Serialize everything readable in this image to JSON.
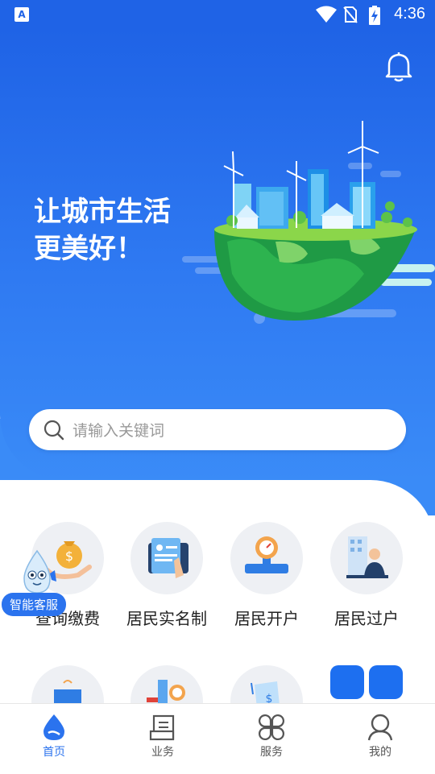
{
  "statusbar": {
    "app_icon": "A",
    "time": "4:36",
    "icons": [
      "wifi-icon",
      "no-sim-icon",
      "battery-charging-icon"
    ]
  },
  "hero": {
    "slogan_line1": "让城市生活",
    "slogan_line2": "更美好！"
  },
  "search": {
    "placeholder": "请输入关键词"
  },
  "services": [
    {
      "label": "查询缴费",
      "icon": "money-bag-icon"
    },
    {
      "label": "居民实名制",
      "icon": "id-card-icon"
    },
    {
      "label": "居民开户",
      "icon": "water-meter-icon"
    },
    {
      "label": "居民过户",
      "icon": "transfer-person-icon"
    }
  ],
  "services_row2": [
    "building-icon",
    "pipe-meter-icon",
    "bill-icon",
    "more-tiles-icon"
  ],
  "assistant": {
    "label": "智能客服"
  },
  "tabs": [
    {
      "label": "首页",
      "icon": "water-drop-icon",
      "active": true
    },
    {
      "label": "业务",
      "icon": "document-icon",
      "active": false
    },
    {
      "label": "服务",
      "icon": "clover-icon",
      "active": false
    },
    {
      "label": "我的",
      "icon": "person-icon",
      "active": false
    }
  ],
  "colors": {
    "primary": "#2b73ee",
    "hero_top": "#1f63e6",
    "hero_bottom": "#3a8bf7"
  }
}
